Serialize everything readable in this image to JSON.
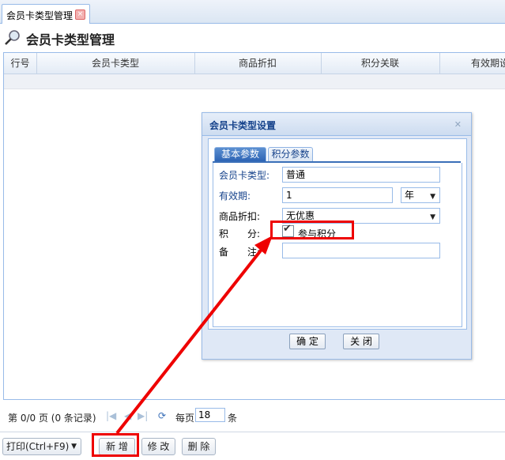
{
  "tab": {
    "label": "会员卡类型管理"
  },
  "header": {
    "title": "会员卡类型管理"
  },
  "grid": {
    "columns": [
      "行号",
      "会员卡类型",
      "商品折扣",
      "积分关联",
      "有效期设"
    ]
  },
  "pager": {
    "page_label": "第 0/0 页 (0 条记录)",
    "per_page_label": "每页",
    "per_page_value": "18",
    "unit_label": "条"
  },
  "toolbar": {
    "print_label": "打印(Ctrl+F9)",
    "add_label": "新 增",
    "edit_label": "修 改",
    "delete_label": "删 除"
  },
  "dialog": {
    "title": "会员卡类型设置",
    "tabs": [
      "基本参数",
      "积分参数"
    ],
    "fields": {
      "card_type_label": "会员卡类型:",
      "card_type_value": "普通",
      "validity_label": "有效期:",
      "validity_value": "1",
      "validity_unit": "年",
      "discount_label": "商品折扣:",
      "discount_value": "无优惠",
      "points_label": "积　　分:",
      "points_checkbox_label": "参与积分",
      "points_checked": true,
      "remark_label": "备　　注:",
      "remark_value": ""
    },
    "ok_label": "确 定",
    "close_label": "关 闭"
  },
  "colors": {
    "accent": "#15428b",
    "annotation": "#ee0000",
    "border": "#99bbe8"
  }
}
